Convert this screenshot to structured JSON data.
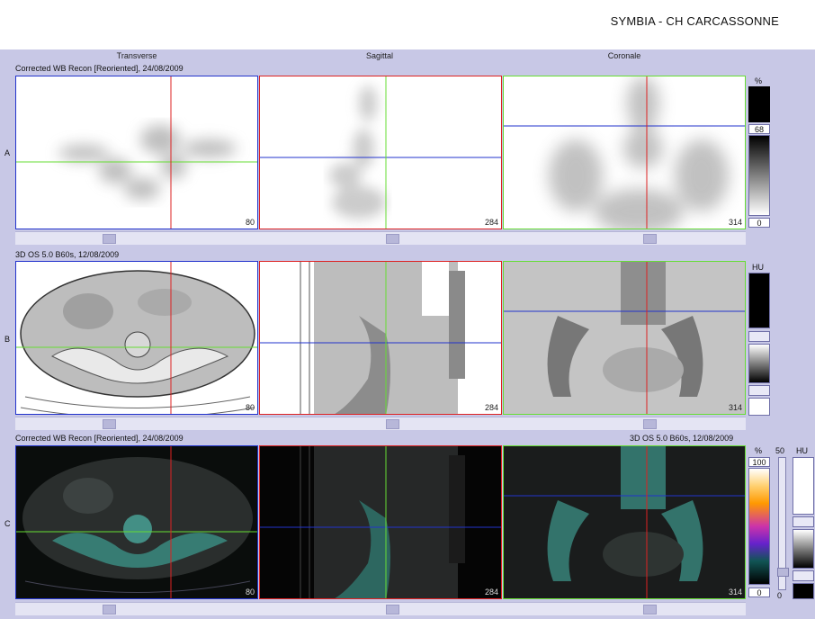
{
  "header": {
    "title": "SYMBIA - CH CARCASSONNE"
  },
  "columns": [
    "Transverse",
    "Sagittal",
    "Coronale"
  ],
  "rows": {
    "A": {
      "label": "A",
      "info_left": "Corrected WB Recon [Reoriented], 24/08/2009",
      "slices": [
        "80",
        "284",
        "314"
      ]
    },
    "B": {
      "label": "B",
      "info_left": "3D  OS  5.0  B60s, 12/08/2009",
      "slices": [
        "80",
        "284",
        "314"
      ]
    },
    "C": {
      "label": "C",
      "info_left": "Corrected WB Recon [Reoriented], 24/08/2009",
      "info_right": "3D  OS  5.0  B60s, 12/08/2009",
      "slices": [
        "80",
        "284",
        "314"
      ]
    }
  },
  "scales": {
    "a": {
      "unit": "%",
      "level": "68",
      "min": "0"
    },
    "b": {
      "unit": "HU"
    },
    "c": {
      "unit_left": "%",
      "max": "100",
      "min": "0",
      "blend_top": "50",
      "blend_bottom": "0",
      "unit_right": "HU"
    }
  },
  "colors": {
    "background": "#c8c8e6",
    "crosshair_red": "#dd2222",
    "crosshair_green": "#66dd33",
    "crosshair_blue": "#2233cc"
  }
}
